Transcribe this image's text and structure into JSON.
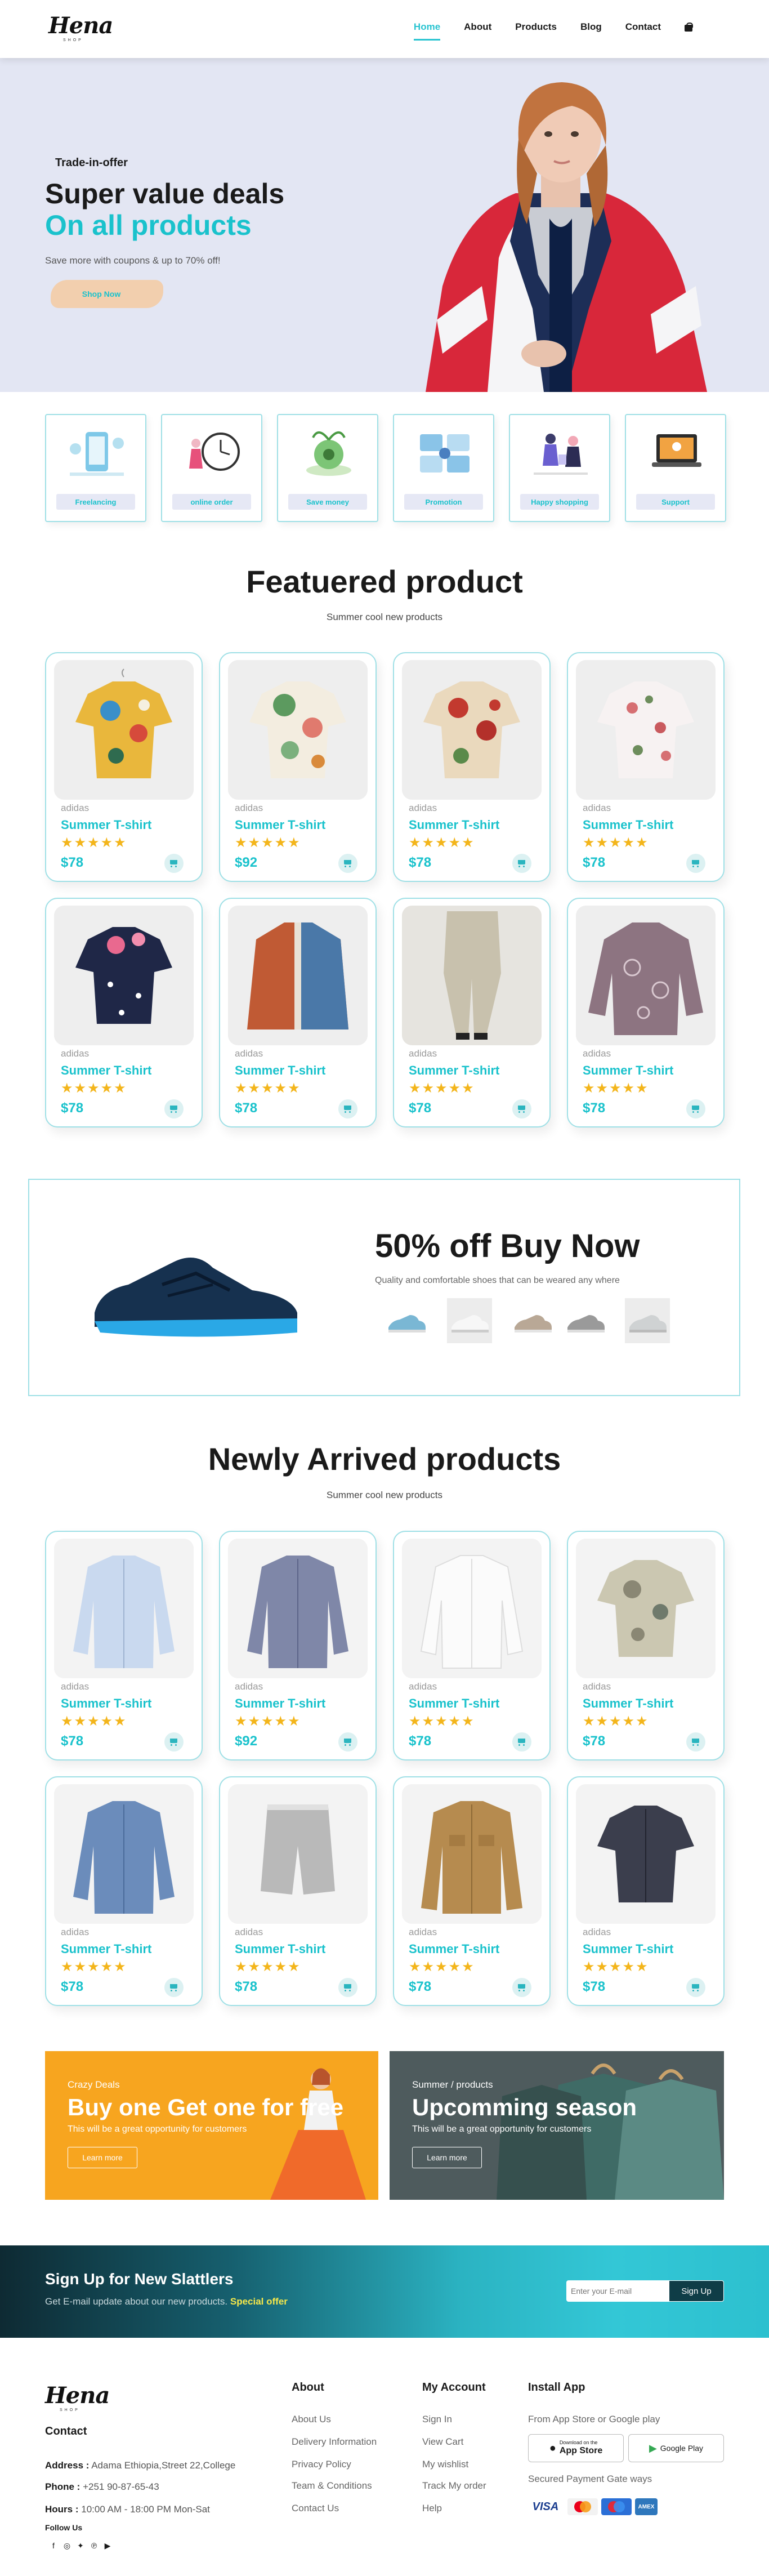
{
  "nav": {
    "logo_text": "Hena",
    "logo_sub": "SHOP",
    "links": [
      "Home",
      "About",
      "Products",
      "Blog",
      "Contact"
    ],
    "cart_icon": "shopping-bag-icon"
  },
  "hero": {
    "kicker": "Trade-in-offer",
    "title_line1": "Super value deals",
    "title_line2": "On all products",
    "subtitle": "Save more with coupons & up to 70% off!",
    "button": "Shop Now"
  },
  "services": [
    {
      "label": "Freelancing"
    },
    {
      "label": "online order"
    },
    {
      "label": "Save money"
    },
    {
      "label": "Promotion"
    },
    {
      "label": "Happy shopping"
    },
    {
      "label": "Support"
    }
  ],
  "featured": {
    "title": "Featuered product",
    "subtitle": "Summer cool new products",
    "products": [
      {
        "brand": "adidas",
        "name": "Summer T-shirt",
        "stars": "★★★★★",
        "price": "$78"
      },
      {
        "brand": "adidas",
        "name": "Summer T-shirt",
        "stars": "★★★★★",
        "price": "$92"
      },
      {
        "brand": "adidas",
        "name": "Summer T-shirt",
        "stars": "★★★★★",
        "price": "$78"
      },
      {
        "brand": "adidas",
        "name": "Summer T-shirt",
        "stars": "★★★★★",
        "price": "$78"
      },
      {
        "brand": "adidas",
        "name": "Summer T-shirt",
        "stars": "★★★★★",
        "price": "$78"
      },
      {
        "brand": "adidas",
        "name": "Summer T-shirt",
        "stars": "★★★★★",
        "price": "$78"
      },
      {
        "brand": "adidas",
        "name": "Summer T-shirt",
        "stars": "★★★★★",
        "price": "$78"
      },
      {
        "brand": "adidas",
        "name": "Summer T-shirt",
        "stars": "★★★★★",
        "price": "$78"
      }
    ]
  },
  "shoe_banner": {
    "title": "50% off Buy Now",
    "subtitle": "Quality and comfortable shoes that can be weared any where"
  },
  "new_arrivals": {
    "title": "Newly Arrived products",
    "subtitle": "Summer cool new products",
    "products": [
      {
        "brand": "adidas",
        "name": "Summer T-shirt",
        "stars": "★★★★★",
        "price": "$78"
      },
      {
        "brand": "adidas",
        "name": "Summer T-shirt",
        "stars": "★★★★★",
        "price": "$92"
      },
      {
        "brand": "adidas",
        "name": "Summer T-shirt",
        "stars": "★★★★★",
        "price": "$78"
      },
      {
        "brand": "adidas",
        "name": "Summer T-shirt",
        "stars": "★★★★★",
        "price": "$78"
      },
      {
        "brand": "adidas",
        "name": "Summer T-shirt",
        "stars": "★★★★★",
        "price": "$78"
      },
      {
        "brand": "adidas",
        "name": "Summer T-shirt",
        "stars": "★★★★★",
        "price": "$78"
      },
      {
        "brand": "adidas",
        "name": "Summer T-shirt",
        "stars": "★★★★★",
        "price": "$78"
      },
      {
        "brand": "adidas",
        "name": "Summer T-shirt",
        "stars": "★★★★★",
        "price": "$78"
      }
    ]
  },
  "promos": [
    {
      "kicker": "Crazy Deals",
      "title": "Buy one Get one for free",
      "text": "This will be a great opportunity for customers",
      "button": "Learn more"
    },
    {
      "kicker": "Summer / products",
      "title": "Upcomming season",
      "text": "This will be a great opportunity for customers",
      "button": "Learn more"
    }
  ],
  "newsletter": {
    "title": "Sign Up for New Slattlers",
    "text": "Get E-mail update about our new products.",
    "highlight": "Special offer",
    "placeholder": "Enter your E-mail",
    "button": "Sign Up"
  },
  "footer": {
    "logo_text": "Hena",
    "logo_sub": "SHOP",
    "contact_heading": "Contact",
    "address_label": "Address :",
    "address": "Adama Ethiopia,Street 22,College",
    "phone_label": "Phone :",
    "phone": "+251 90-87-65-43",
    "hours_label": "Hours :",
    "hours": "10:00 AM - 18:00 PM Mon-Sat",
    "follow": "Follow Us",
    "social_icons": [
      "facebook-icon",
      "instagram-icon",
      "twitter-icon",
      "pinterest-icon",
      "youtube-icon"
    ],
    "about_heading": "About",
    "about_links": [
      "About Us",
      "Delivery Information",
      "Privacy Policy",
      "Team & Conditions",
      "Contact Us"
    ],
    "account_heading": "My Account",
    "account_links": [
      "Sign In",
      "View Cart",
      "My wishlist",
      "Track My order",
      "Help"
    ],
    "app_heading": "Install App",
    "app_text": "From App Store or Google play",
    "app_store": "App Store",
    "app_store_small": "Download on the",
    "google_play": "Google Play",
    "payment_text": "Secured Payment Gate ways",
    "payment_cards": [
      "VISA",
      "MC",
      "Maestro",
      "AMEX"
    ]
  },
  "colors": {
    "accent": "#1ac2cc",
    "hero_bg": "#e3e6f3",
    "star": "#f3b51b",
    "promo_orange": "#f7a51f",
    "promo_gray": "#4a5558"
  }
}
